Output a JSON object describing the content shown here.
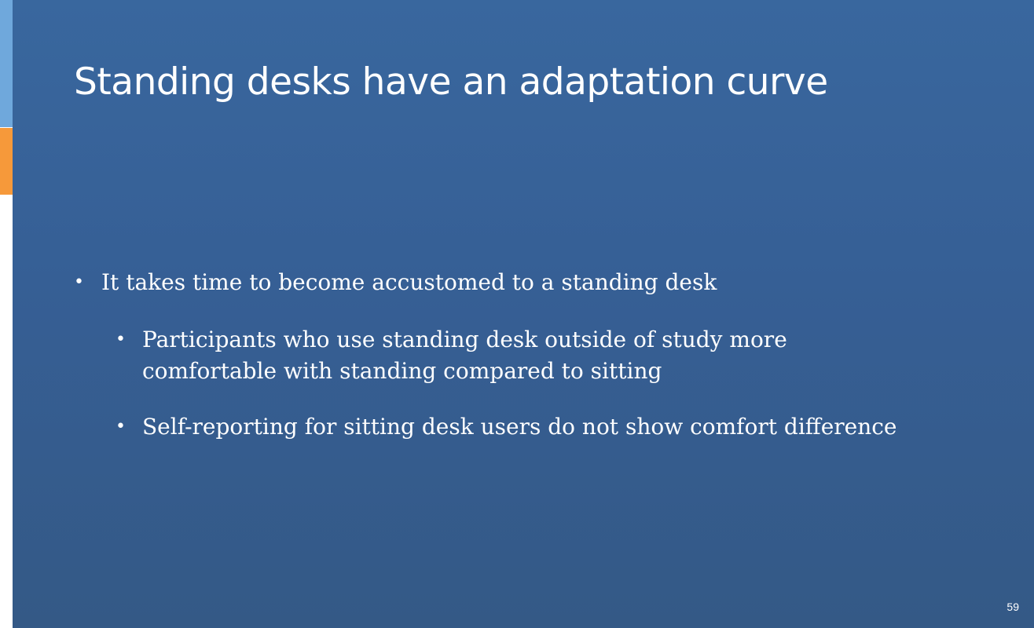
{
  "slide": {
    "title": "Standing desks have an adaptation curve",
    "bullet_glyph": "•",
    "bullets": [
      {
        "level": 1,
        "text": "It takes time to become accustomed to a standing desk"
      },
      {
        "level": 2,
        "text": "Participants who use standing desk outside of study more comfortable with standing compared to sitting"
      },
      {
        "level": 2,
        "text": "Self-reporting for sitting desk users do not show comfort difference"
      }
    ],
    "page_number": "59"
  },
  "colors": {
    "background_top": "#39679e",
    "background_bottom": "#345986",
    "accent_blue": "#6fa8dc",
    "accent_orange": "#f6993a",
    "text": "#ffffff"
  }
}
